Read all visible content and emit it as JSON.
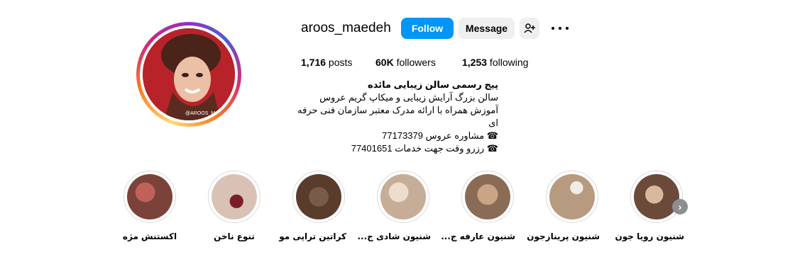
{
  "profile": {
    "username": "aroos_maedeh",
    "follow_label": "Follow",
    "message_label": "Message",
    "avatar_watermark": "@AROOS_MAEDEH",
    "stats": {
      "posts_value": "1,716",
      "posts_label": " posts",
      "followers_value": "60K",
      "followers_label": " followers",
      "following_value": "1,253",
      "following_label": " following"
    },
    "bio": {
      "name": "پیج رسمی سالن زیبایی مائده",
      "lines": [
        "سالن بزرگ آرایش زیبایی و میکاپ گریم عروس",
        "آموزش همراه با ارائه مدرک معتبر سازمان فنی حرفه ای",
        "☎ مشاوره عروس 77173379",
        "☎ رزرو وقت جهت خدمات 77401651"
      ]
    }
  },
  "highlights": [
    {
      "label": "شنیون رویا جون",
      "color": "#6b4a3a"
    },
    {
      "label": "شنیون پریناز‌جون",
      "color": "#b89a80"
    },
    {
      "label": "شنیون عارفه ج...",
      "color": "#8a6b55"
    },
    {
      "label": "شنیون شادی ج...",
      "color": "#c6ad98"
    },
    {
      "label": "کراتین تراپی مو",
      "color": "#5a3c2c"
    },
    {
      "label": "تنوع ناخن",
      "color": "#d9c2b5"
    },
    {
      "label": "اکستنش مژه",
      "color": "#7a4238"
    }
  ],
  "colors": {
    "accent": "#0095f6",
    "secondary_button": "#efefef"
  }
}
